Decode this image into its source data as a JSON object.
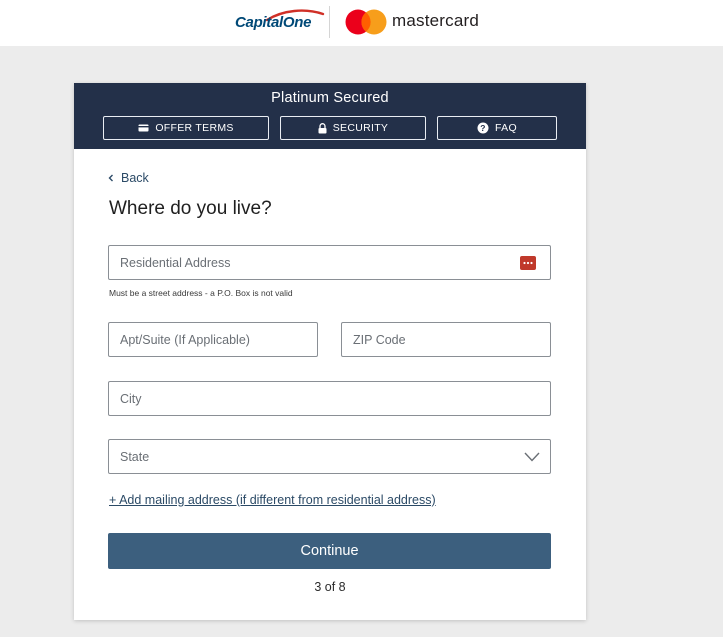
{
  "brand": {
    "capital_one": "CapitalOne",
    "mastercard": "mastercard",
    "colors": {
      "capital_one_blue": "#004977",
      "capital_one_red": "#d03027",
      "mc_red": "#eb001b",
      "mc_orange": "#f79e1b",
      "mc_overlap": "#ff5f00"
    }
  },
  "card": {
    "title": "Platinum Secured",
    "header_bg": "#233049",
    "buttons": [
      {
        "label": "OFFER TERMS",
        "icon": "credit-card-icon"
      },
      {
        "label": "SECURITY",
        "icon": "lock-icon"
      },
      {
        "label": "FAQ",
        "icon": "question-circle-icon"
      }
    ]
  },
  "form": {
    "back_label": "Back",
    "title": "Where do you live?",
    "address_placeholder": "Residential Address",
    "address_helper": "Must be a street address - a P.O. Box is not valid",
    "apt_placeholder": "Apt/Suite (If Applicable)",
    "zip_placeholder": "ZIP Code",
    "city_placeholder": "City",
    "state_placeholder": "State",
    "mailing_link": "+ Add mailing address (if different from residential address)",
    "continue_label": "Continue",
    "continue_color": "#3c5f7e",
    "step_text": "3 of 8"
  }
}
